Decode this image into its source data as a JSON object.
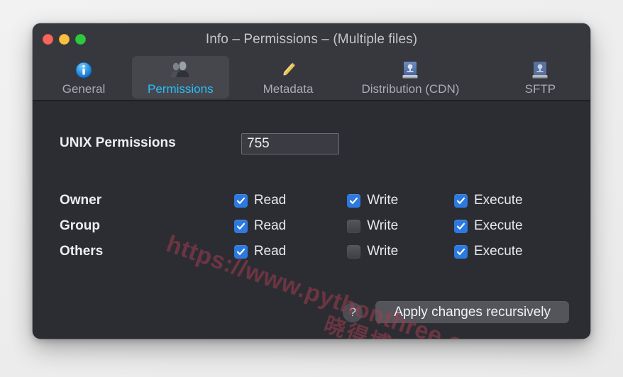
{
  "window": {
    "title": "Info – Permissions – (Multiple files)",
    "traffic_lights": [
      {
        "name": "close",
        "color": "#f9645c"
      },
      {
        "name": "minimize",
        "color": "#fbbe3f"
      },
      {
        "name": "zoom",
        "color": "#2ec840"
      }
    ]
  },
  "toolbar": {
    "tabs": [
      {
        "label": "General",
        "icon": "info-circle-icon",
        "selected": false
      },
      {
        "label": "Permissions",
        "icon": "users-icon",
        "selected": true
      },
      {
        "label": "Metadata",
        "icon": "pencil-icon",
        "selected": false
      },
      {
        "label": "Distribution (CDN)",
        "icon": "server-drive-icon",
        "selected": false
      },
      {
        "label": "SFTP",
        "icon": "server-drive-icon",
        "selected": false
      }
    ],
    "selected_accent": "#29bffb"
  },
  "main": {
    "unix_permissions": {
      "label": "UNIX Permissions",
      "value": "755",
      "placeholder": ""
    },
    "columns": [
      "Read",
      "Write",
      "Execute"
    ],
    "rows": [
      {
        "name": "Owner",
        "read": {
          "label": "Read",
          "checked": true
        },
        "write": {
          "label": "Write",
          "checked": true
        },
        "execute": {
          "label": "Execute",
          "checked": true
        }
      },
      {
        "name": "Group",
        "read": {
          "label": "Read",
          "checked": true
        },
        "write": {
          "label": "Write",
          "checked": false
        },
        "execute": {
          "label": "Execute",
          "checked": true
        }
      },
      {
        "name": "Others",
        "read": {
          "label": "Read",
          "checked": true
        },
        "write": {
          "label": "Write",
          "checked": false
        },
        "execute": {
          "label": "Execute",
          "checked": true
        }
      }
    ]
  },
  "footer": {
    "help_label": "?",
    "apply_label": "Apply changes recursively"
  },
  "watermark": {
    "url": "https://www.pythonthree.com",
    "text_cn": "晓得博客",
    "color": "#a03c4e"
  }
}
